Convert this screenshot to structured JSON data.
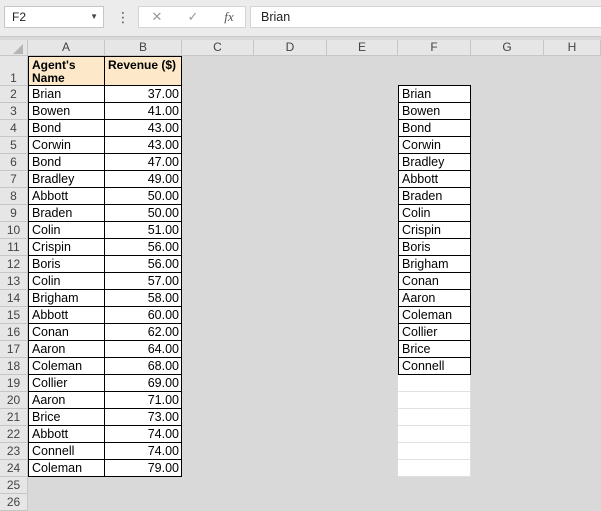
{
  "formula_bar": {
    "name_box": "F2",
    "formula": "Brian",
    "dots": "⋮",
    "cancel_glyph": "✕",
    "enter_glyph": "✓",
    "fx_glyph": "fx"
  },
  "columns": [
    "A",
    "B",
    "C",
    "D",
    "E",
    "F",
    "G",
    "H"
  ],
  "rows": [
    "1",
    "2",
    "3",
    "4",
    "5",
    "6",
    "7",
    "8",
    "9",
    "10",
    "11",
    "12",
    "13",
    "14",
    "15",
    "16",
    "17",
    "18",
    "19",
    "20",
    "21",
    "22",
    "23",
    "24",
    "25",
    "26"
  ],
  "table": {
    "header_name": "Agent's Name",
    "header_revenue": "Revenue ($)",
    "names": [
      "Brian",
      "Bowen",
      "Bond",
      "Corwin",
      "Bond",
      "Bradley",
      "Abbott",
      "Braden",
      "Colin",
      "Crispin",
      "Boris",
      "Colin",
      "Brigham",
      "Abbott",
      "Conan",
      "Aaron",
      "Coleman",
      "Collier",
      "Aaron",
      "Brice",
      "Abbott",
      "Connell",
      "Coleman"
    ],
    "revenues": [
      "37.00",
      "41.00",
      "43.00",
      "43.00",
      "47.00",
      "49.00",
      "50.00",
      "50.00",
      "51.00",
      "56.00",
      "56.00",
      "57.00",
      "58.00",
      "60.00",
      "62.00",
      "64.00",
      "68.00",
      "69.00",
      "71.00",
      "73.00",
      "74.00",
      "74.00",
      "79.00"
    ]
  },
  "unique_list": [
    "Brian",
    "Bowen",
    "Bond",
    "Corwin",
    "Bradley",
    "Abbott",
    "Braden",
    "Colin",
    "Crispin",
    "Boris",
    "Brigham",
    "Conan",
    "Aaron",
    "Coleman",
    "Collier",
    "Brice",
    "Connell"
  ]
}
